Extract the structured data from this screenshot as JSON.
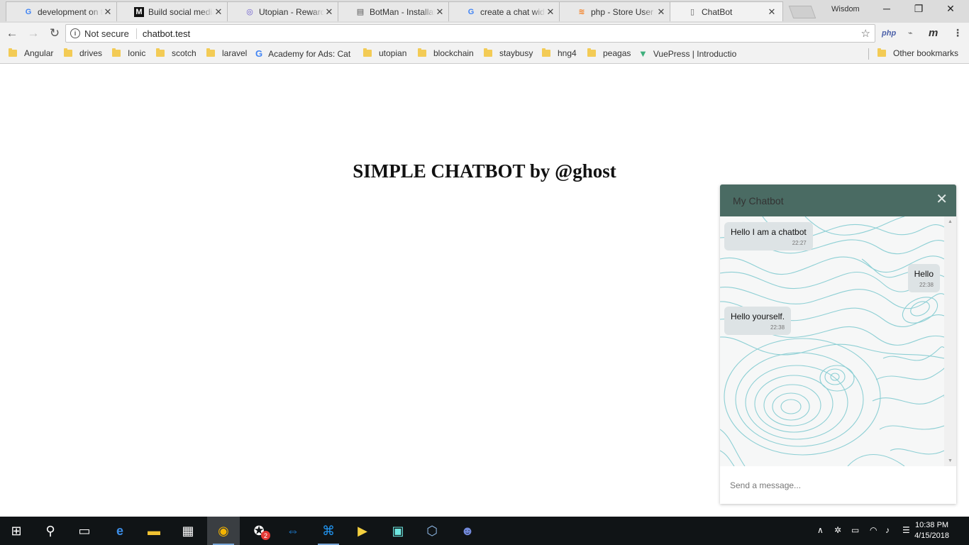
{
  "browser": {
    "tabs": [
      {
        "icon": "google-icon",
        "label": "development on the"
      },
      {
        "icon": "medium-icon",
        "label": "Build social media"
      },
      {
        "icon": "utopian-icon",
        "label": "Utopian - Rewarding"
      },
      {
        "icon": "botman-icon",
        "label": "BotMan - Installation"
      },
      {
        "icon": "google-icon",
        "label": "create a chat widget"
      },
      {
        "icon": "stackoverflow-icon",
        "label": "php - Store User m"
      },
      {
        "icon": "page-icon",
        "label": "ChatBot"
      }
    ],
    "profile_name": "Wisdom",
    "security_label": "Not secure",
    "url": "chatbot.test",
    "bookmarks": [
      {
        "type": "folder",
        "label": "Angular"
      },
      {
        "type": "folder",
        "label": "drives"
      },
      {
        "type": "folder",
        "label": "Ionic"
      },
      {
        "type": "folder",
        "label": "scotch"
      },
      {
        "type": "folder",
        "label": "laravel"
      },
      {
        "type": "google",
        "label": "Academy for Ads: Cat"
      },
      {
        "type": "folder",
        "label": "utopian"
      },
      {
        "type": "folder",
        "label": "blockchain"
      },
      {
        "type": "folder",
        "label": "staybusy"
      },
      {
        "type": "folder",
        "label": "hng4"
      },
      {
        "type": "folder",
        "label": "peagas"
      },
      {
        "type": "vue",
        "label": "VuePress | Introductio"
      }
    ],
    "other_bookmarks": "Other bookmarks",
    "extensions": [
      "php",
      "m"
    ]
  },
  "page": {
    "title": "SIMPLE CHATBOT by @ghost"
  },
  "chat": {
    "title": "My Chatbot",
    "messages": [
      {
        "side": "left",
        "text": "Hello I am a chatbot",
        "time": "22:27"
      },
      {
        "side": "right",
        "text": "Hello",
        "time": "22:38"
      },
      {
        "side": "left",
        "text": "Hello yourself.",
        "time": "22:38"
      }
    ],
    "input_placeholder": "Send a message...",
    "colors": {
      "header": "#4a6b63",
      "bubble": "#dde3e5",
      "contour": "#7cc9cf"
    }
  },
  "taskbar": {
    "apps": [
      "start-icon",
      "search-icon",
      "task-view-icon",
      "edge-icon",
      "file-explorer-icon",
      "store-icon",
      "chrome-icon",
      "game-app-icon",
      "teamviewer-icon",
      "vscode-icon",
      "player-icon",
      "terminal-icon",
      "virtualbox-icon",
      "discord-icon"
    ],
    "badge_count": "2",
    "time": "10:38 PM",
    "date": "4/15/2018"
  }
}
